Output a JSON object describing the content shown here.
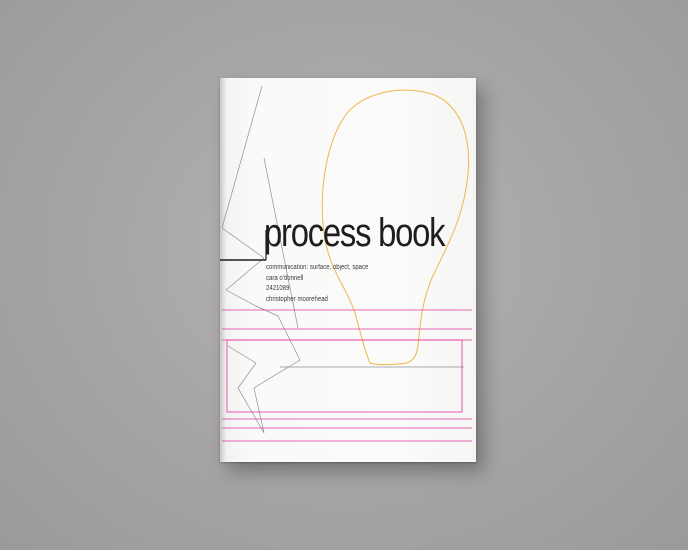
{
  "book": {
    "title": "process book",
    "subtitle": "communication: surface, object, space",
    "author": "cara o'donnell",
    "student_id": "2421089",
    "tutor": "christopher moorehead"
  },
  "colors": {
    "background": "#a8a7a5",
    "cover": "#fafaf8",
    "bulb_outline": "#f0b54a",
    "guide_lines": "#e0359b",
    "sketch_lines": "#8a8a96",
    "title_text": "#1e1e1e"
  },
  "decorations": [
    "lightbulb-outline-graphic",
    "magenta-grid-lines-graphic",
    "grey-sketch-lines-graphic"
  ]
}
